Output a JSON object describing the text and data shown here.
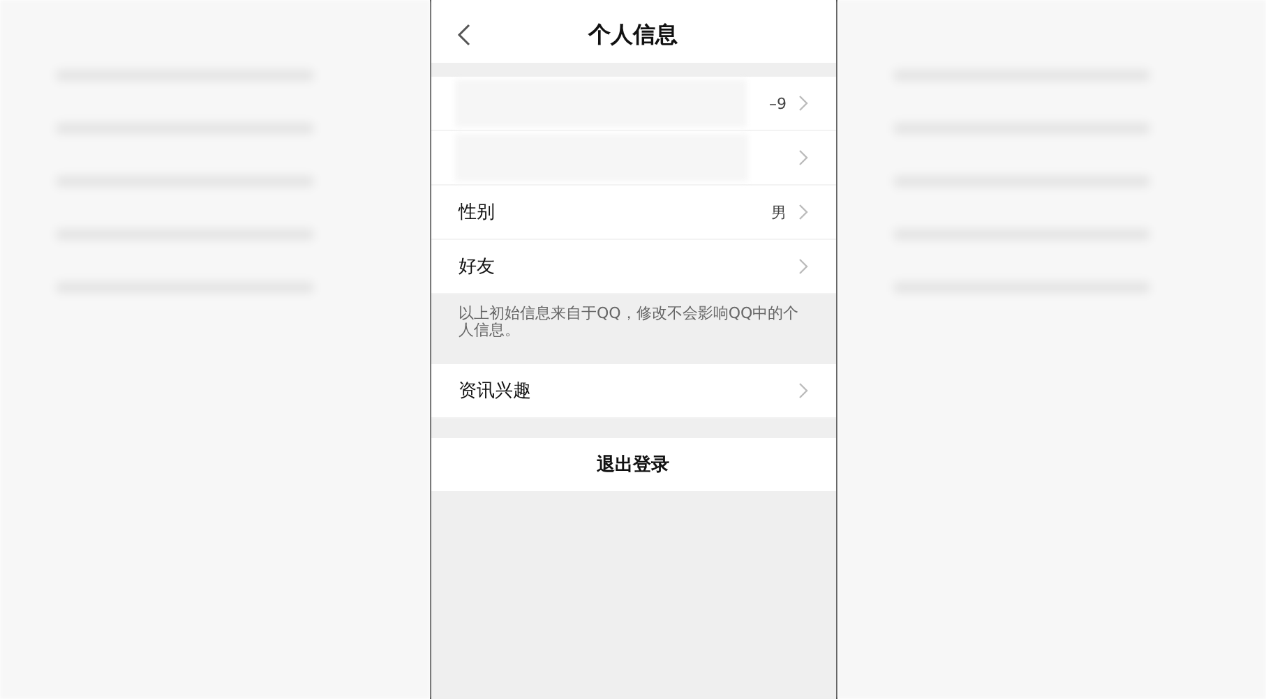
{
  "header": {
    "title": "个人信息"
  },
  "rows": [
    {
      "kind": "blurred",
      "value": "–9"
    },
    {
      "kind": "blurred"
    },
    {
      "kind": "plain",
      "label": "性别",
      "value": "男"
    },
    {
      "kind": "plain",
      "label": "好友"
    }
  ],
  "note": "以上初始信息来自于QQ，修改不会影响QQ中的个人信息。",
  "more_rows": [
    {
      "kind": "plain",
      "label": "资讯兴趣"
    }
  ],
  "logout_button": "退出登录"
}
